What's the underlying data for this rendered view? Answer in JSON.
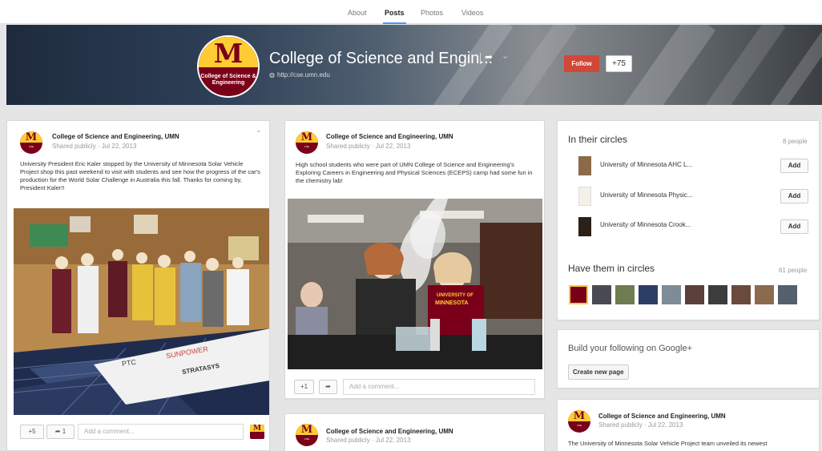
{
  "nav": {
    "tabs": [
      {
        "label": "About"
      },
      {
        "label": "Posts"
      },
      {
        "label": "Photos"
      },
      {
        "label": "Videos"
      }
    ]
  },
  "profile": {
    "name": "College of Science and Engin...",
    "url": "http://cse.umn.edu",
    "follow_label": "Follow",
    "plus_count": "+75",
    "logo_letter": "M",
    "logo_text": "College of Science & Engineering"
  },
  "posts": [
    {
      "author": "College of Science and Engineering, UMN",
      "meta": "Shared publicly  ·  Jul 22, 2013",
      "text": "University President Eric Kaler stopped by the University of Minnesota Solar Vehicle Project shop this past weekend to visit with students and see how the progress of the car's production for the World Solar Challenge in Australia this fall. Thanks for coming by, President Kaler!!",
      "plus": "+5",
      "shares": "1",
      "comment_placeholder": "Add a comment...",
      "photo_words": [
        "PTC",
        "SUNPOWER",
        "STRATASYS"
      ]
    },
    {
      "author": "College of Science and Engineering, UMN",
      "meta": "Shared publicly  ·  Jul 22, 2013",
      "text": "High school students who were part of UMN College of Science and Engineering's Exploring Careers in Engineering and Physical Sciences (ECEPS) camp had some fun in the chemistry lab!",
      "plus": "+1",
      "comment_placeholder": "Add a comment...",
      "photo_words": [
        "UNIVERSITY OF",
        "MINNESOTA"
      ]
    },
    {
      "author": "College of Science and Engineering, UMN",
      "meta": "Shared publicly  ·  Jul 22, 2013"
    }
  ],
  "sidebar": {
    "in_circles": {
      "title": "In their circles",
      "count": "8 people",
      "items": [
        {
          "name": "University of Minnesota AHC L...",
          "add": "Add"
        },
        {
          "name": "University of Minnesota Physic...",
          "add": "Add"
        },
        {
          "name": "University of Minnesota Crook...",
          "add": "Add"
        }
      ]
    },
    "have_circles": {
      "title": "Have them in circles",
      "count": "61 people"
    },
    "build": {
      "title": "Build your following on Google+",
      "button": "Create new page"
    },
    "post": {
      "author": "College of Science and Engineering, UMN",
      "meta": "Shared publicly  ·  Jul 22, 2013",
      "text": "The University of Minnesota Solar Vehicle Project team unveiled its newest"
    }
  },
  "colors": {
    "accent": "#4d90fe",
    "follow": "#d14836",
    "maroon": "#7a0019",
    "gold": "#ffcc33"
  }
}
